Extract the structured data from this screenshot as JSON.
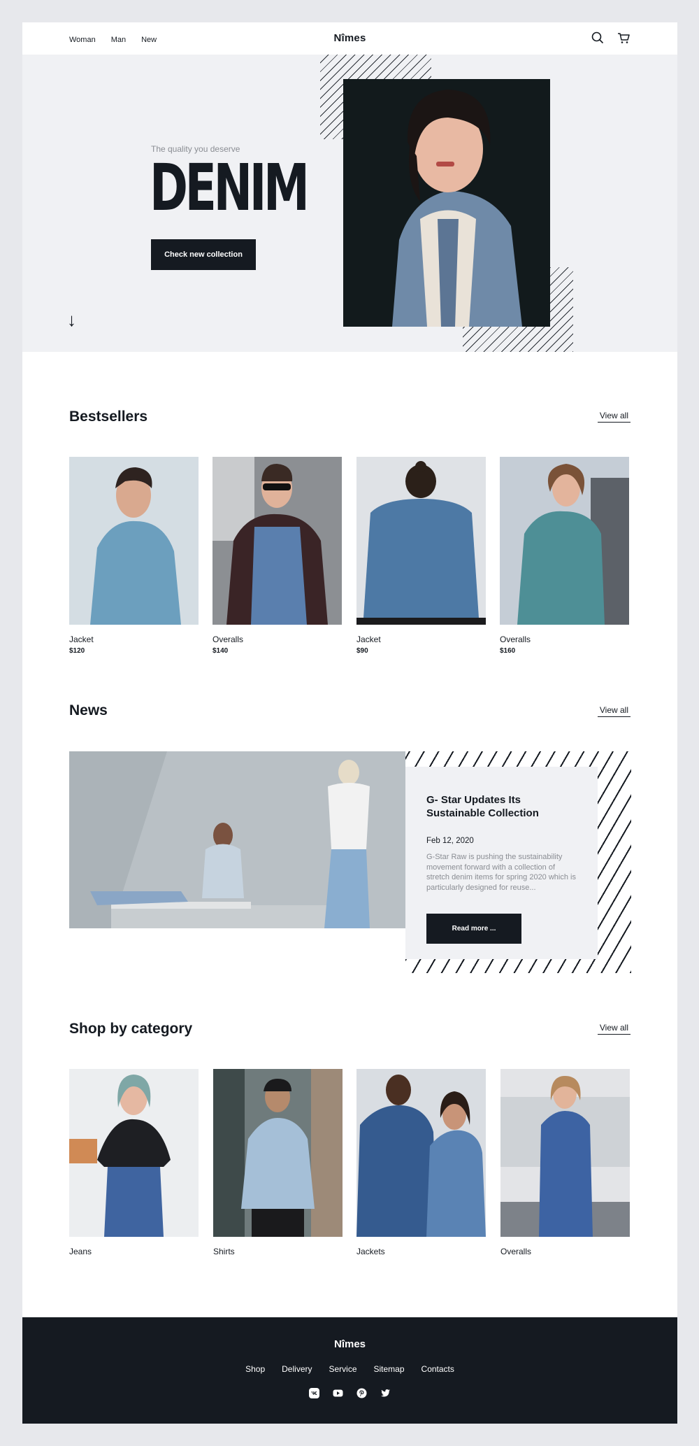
{
  "header": {
    "nav": [
      "Woman",
      "Man",
      "New"
    ],
    "logo": "Nîmes",
    "icons": [
      "search-icon",
      "cart-icon"
    ]
  },
  "hero": {
    "tagline": "The quality you deserve",
    "title": "DENIM",
    "cta": "Check new collection",
    "scroll_icon": "arrow-down-icon"
  },
  "bestsellers": {
    "title": "Bestsellers",
    "view_all": "View all",
    "items": [
      {
        "name": "Jacket",
        "price": "$120"
      },
      {
        "name": "Overalls",
        "price": "$140"
      },
      {
        "name": "Jacket",
        "price": "$90"
      },
      {
        "name": "Overalls",
        "price": "$160"
      }
    ]
  },
  "news": {
    "title": "News",
    "view_all": "View all",
    "article": {
      "title": "G- Star Updates Its Sustainable Collection",
      "date": "Feb 12, 2020",
      "excerpt": "G-Star Raw is pushing the sustainability movement forward with a collection of stretch denim items for spring 2020 which is particularly designed for reuse...",
      "button": "Read more ..."
    }
  },
  "categories": {
    "title": "Shop by category",
    "view_all": "View all",
    "items": [
      "Jeans",
      "Shirts",
      "Jackets",
      "Overalls"
    ]
  },
  "footer": {
    "logo": "Nîmes",
    "links": [
      "Shop",
      "Delivery",
      "Service",
      "Sitemap",
      "Contacts"
    ],
    "social": [
      "vk-icon",
      "youtube-icon",
      "pinterest-icon",
      "twitter-icon"
    ]
  },
  "colors": {
    "background": "#e7e8ec",
    "dark": "#151a21",
    "hero_bg": "#f0f1f4",
    "muted_text": "#8a8d93"
  }
}
